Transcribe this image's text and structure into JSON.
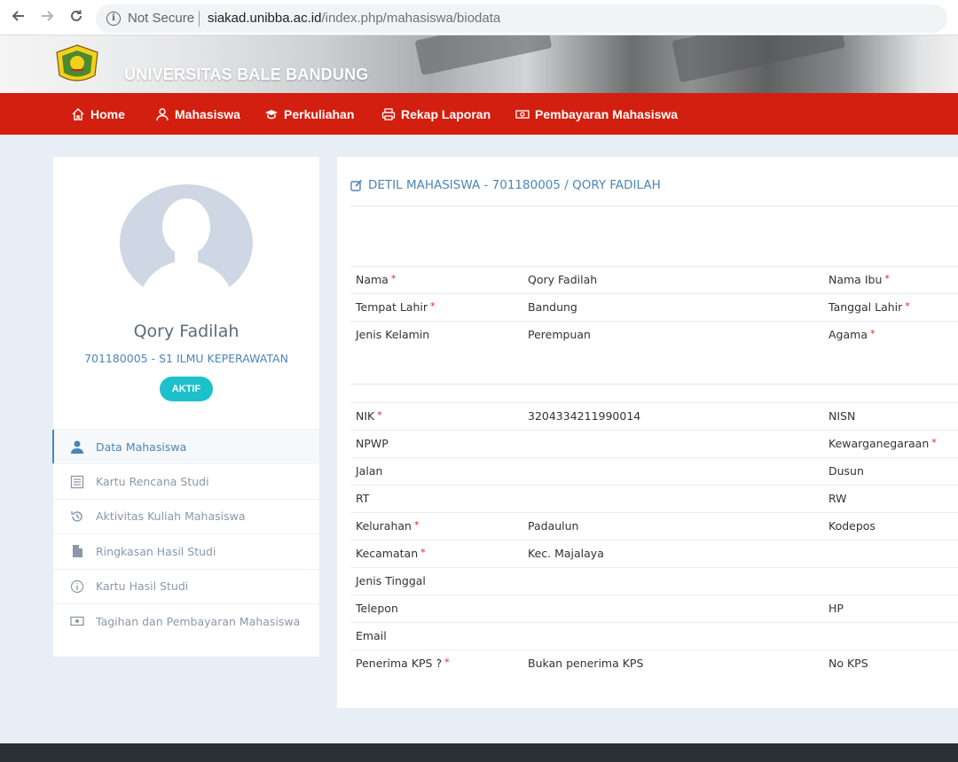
{
  "browser": {
    "security_label": "Not Secure",
    "url_host": "siakad.unibba.ac.id",
    "url_path": "/index.php/mahasiswa/biodata"
  },
  "site": {
    "name": "UNIVERSITAS BALE BANDUNG"
  },
  "navbar": {
    "items": [
      {
        "label": "Home",
        "icon": "home-icon"
      },
      {
        "label": "Mahasiswa",
        "icon": "user-icon"
      },
      {
        "label": "Perkuliahan",
        "icon": "graduation-cap-icon"
      },
      {
        "label": "Rekap Laporan",
        "icon": "printer-icon"
      },
      {
        "label": "Pembayaran Mahasiswa",
        "icon": "money-icon"
      }
    ]
  },
  "profile": {
    "name": "Qory Fadilah",
    "id_program": "701180005 - S1 ILMU KEPERAWATAN",
    "status": "AKTIF"
  },
  "sidebar_menu": [
    {
      "label": "Data Mahasiswa",
      "icon": "user-icon",
      "active": true
    },
    {
      "label": "Kartu Rencana Studi",
      "icon": "list-icon",
      "active": false
    },
    {
      "label": "Aktivitas Kuliah Mahasiswa",
      "icon": "history-icon",
      "active": false
    },
    {
      "label": "Ringkasan Hasil Studi",
      "icon": "file-icon",
      "active": false
    },
    {
      "label": "Kartu Hasil Studi",
      "icon": "info-icon",
      "active": false
    },
    {
      "label": "Tagihan dan Pembayaran Mahasiswa",
      "icon": "money-icon",
      "active": false
    }
  ],
  "detail": {
    "title": "DETIL MAHASISWA - 701180005 / QORY FADILAH",
    "section1": [
      {
        "label": "Nama",
        "required": "*",
        "value": "Qory Fadilah",
        "label2": "Nama Ibu",
        "required2": "*"
      },
      {
        "label": "Tempat Lahir",
        "required": "*",
        "value": "Bandung",
        "label2": "Tanggal Lahir",
        "required2": "*"
      },
      {
        "label": "Jenis Kelamin",
        "required": "",
        "value": "Perempuan",
        "label2": "Agama",
        "required2": "*"
      }
    ],
    "section2": [
      {
        "label": "NIK",
        "required": "*",
        "value": "3204334211990014",
        "label2": "NISN",
        "required2": ""
      },
      {
        "label": "NPWP",
        "required": "",
        "value": "",
        "label2": "Kewarganegaraan",
        "required2": "*"
      },
      {
        "label": "Jalan",
        "required": "",
        "value": "",
        "label2": "Dusun",
        "required2": ""
      },
      {
        "label": "RT",
        "required": "",
        "value": "",
        "label2": "RW",
        "required2": ""
      },
      {
        "label": "Kelurahan",
        "required": "*",
        "value": "Padaulun",
        "label2": "Kodepos",
        "required2": ""
      },
      {
        "label": "Kecamatan",
        "required": "*",
        "value": "Kec. Majalaya",
        "label2": "",
        "required2": ""
      },
      {
        "label": "Jenis Tinggal",
        "required": "",
        "value": "",
        "label2": "",
        "required2": ""
      },
      {
        "label": "Telepon",
        "required": "",
        "value": "",
        "label2": "HP",
        "required2": ""
      },
      {
        "label": "Email",
        "required": "",
        "value": "",
        "label2": "",
        "required2": ""
      },
      {
        "label": "Penerima KPS ?",
        "required": "*",
        "value": "Bukan penerima KPS",
        "label2": "No KPS",
        "required2": ""
      }
    ]
  },
  "colors": {
    "navbar": "#d21f0f",
    "accent": "#4a86b6",
    "badge": "#1cc1cb",
    "required": "#e02424"
  }
}
